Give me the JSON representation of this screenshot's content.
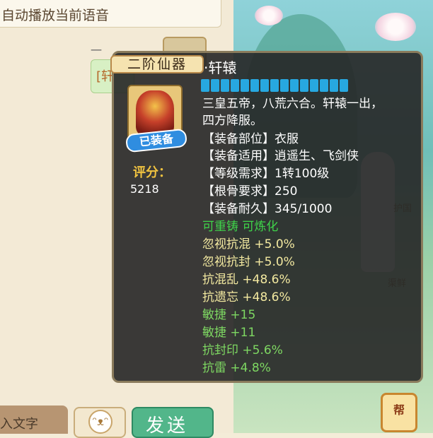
{
  "chat": {
    "autoplay_label": "自动播放当前语音",
    "sender_name": "一",
    "bubble_text": "[轩"
  },
  "bottom_bar": {
    "input_placeholder": "入文字",
    "send_label": "发送"
  },
  "scene": {
    "label_1": "护国",
    "label_2": "渠鲜"
  },
  "tooltip": {
    "tier": "二阶仙器",
    "item_name": "·轩辕",
    "gauge_segments": 15,
    "equipped_badge": "已装备",
    "score_label": "评分：",
    "score_value": "5218",
    "description": [
      "三皇五帝，八荒六合。轩辕一出，",
      "四方降服。"
    ],
    "stats": [
      {
        "label": "【装备部位】衣服"
      },
      {
        "label": "【装备适用】逍遥生、飞剑侠"
      },
      {
        "label": "【等级需求】1转100级"
      },
      {
        "label": "【根骨要求】250"
      },
      {
        "label": "【装备耐久】345/1000"
      }
    ],
    "attributes": [
      {
        "text": "可重铸 可炼化",
        "color": "#3fd44a"
      },
      {
        "text": "忽视抗混 +5.0%",
        "color": "#f3e9a0"
      },
      {
        "text": "忽视抗封 +5.0%",
        "color": "#f3e9a0"
      },
      {
        "text": "抗混乱 +48.6%",
        "color": "#f3e9a0"
      },
      {
        "text": "抗遗忘 +48.6%",
        "color": "#f3e9a0"
      },
      {
        "text": "敏捷 +15",
        "color": "#7ed862"
      },
      {
        "text": "敏捷 +11",
        "color": "#7ed862"
      },
      {
        "text": "抗封印 +5.6%",
        "color": "#7ed862"
      },
      {
        "text": "抗雷 +4.8%",
        "color": "#7ed862"
      }
    ]
  },
  "help_icon": "帮"
}
